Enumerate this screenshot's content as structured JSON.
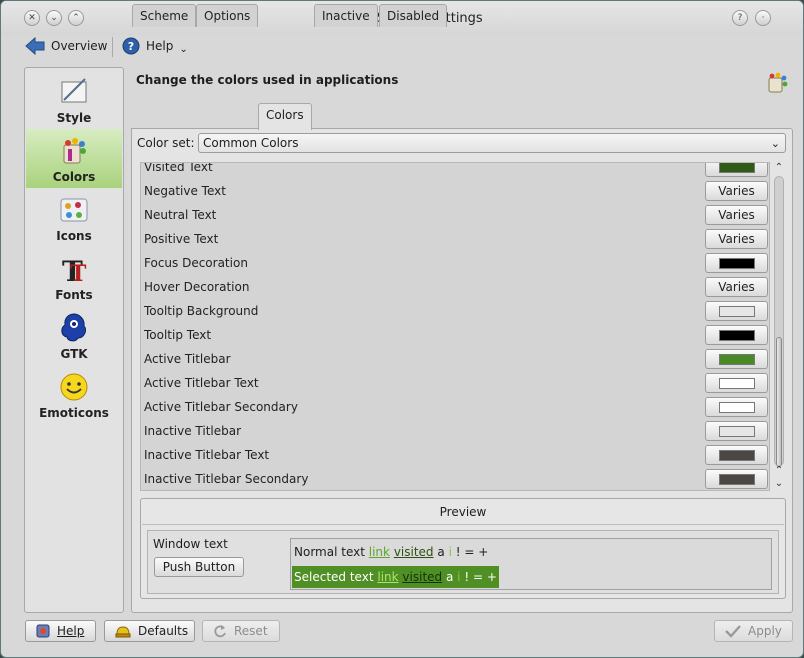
{
  "window": {
    "title": "Colors – System Settings",
    "titlebar_buttons": [
      "close",
      "minimize",
      "maximize"
    ],
    "right_buttons": [
      "help",
      "shade"
    ]
  },
  "toolbar": {
    "overview_label": "Overview",
    "help_label": "Help"
  },
  "sidebar": {
    "items": [
      {
        "label": "Style",
        "icon": "style-icon",
        "active": false
      },
      {
        "label": "Colors",
        "icon": "colors-icon",
        "active": true
      },
      {
        "label": "Icons",
        "icon": "icons-icon",
        "active": false
      },
      {
        "label": "Fonts",
        "icon": "fonts-icon",
        "active": false
      },
      {
        "label": "GTK",
        "icon": "gtk-icon",
        "active": false
      },
      {
        "label": "Emoticons",
        "icon": "emoticons-icon",
        "active": false
      }
    ]
  },
  "main": {
    "heading": "Change the colors used in applications",
    "tabs": [
      {
        "label": "Scheme",
        "active": false
      },
      {
        "label": "Options",
        "active": false
      },
      {
        "label": "Colors",
        "active": true
      },
      {
        "label": "Inactive",
        "active": false
      },
      {
        "label": "Disabled",
        "active": false
      }
    ],
    "color_set_label": "Color set:",
    "color_set_value": "Common Colors",
    "rows": [
      {
        "name": "Visited Text",
        "kind": "swatch",
        "color": "#2f5a18"
      },
      {
        "name": "Negative Text",
        "kind": "varies",
        "label": "Varies"
      },
      {
        "name": "Neutral Text",
        "kind": "varies",
        "label": "Varies"
      },
      {
        "name": "Positive Text",
        "kind": "varies",
        "label": "Varies"
      },
      {
        "name": "Focus Decoration",
        "kind": "swatch",
        "color": "#000000"
      },
      {
        "name": "Hover Decoration",
        "kind": "varies",
        "label": "Varies"
      },
      {
        "name": "Tooltip Background",
        "kind": "swatch",
        "color": "#e6e6e6"
      },
      {
        "name": "Tooltip Text",
        "kind": "swatch",
        "color": "#000000"
      },
      {
        "name": "Active Titlebar",
        "kind": "swatch",
        "color": "#4a8a26"
      },
      {
        "name": "Active Titlebar Text",
        "kind": "swatch",
        "color": "#ffffff"
      },
      {
        "name": "Active Titlebar Secondary",
        "kind": "swatch",
        "color": "#ffffff"
      },
      {
        "name": "Inactive Titlebar",
        "kind": "swatch",
        "color": "#e6e6e6"
      },
      {
        "name": "Inactive Titlebar Text",
        "kind": "swatch",
        "color": "#4a4744"
      },
      {
        "name": "Inactive Titlebar Secondary",
        "kind": "swatch",
        "color": "#4a4744"
      }
    ]
  },
  "preview": {
    "title": "Preview",
    "window_text": "Window text",
    "push_button": "Push Button",
    "normal_text": "Normal text",
    "link": "link",
    "visited": "visited",
    "tail": "a",
    "symbols": "! = +",
    "selected_text": "Selected text"
  },
  "buttons": {
    "help": "Help",
    "defaults": "Defaults",
    "reset": "Reset",
    "apply": "Apply"
  },
  "colors": {
    "accent_green": "#4f8f24",
    "selection_gradient_top": "#d7ecc2"
  }
}
